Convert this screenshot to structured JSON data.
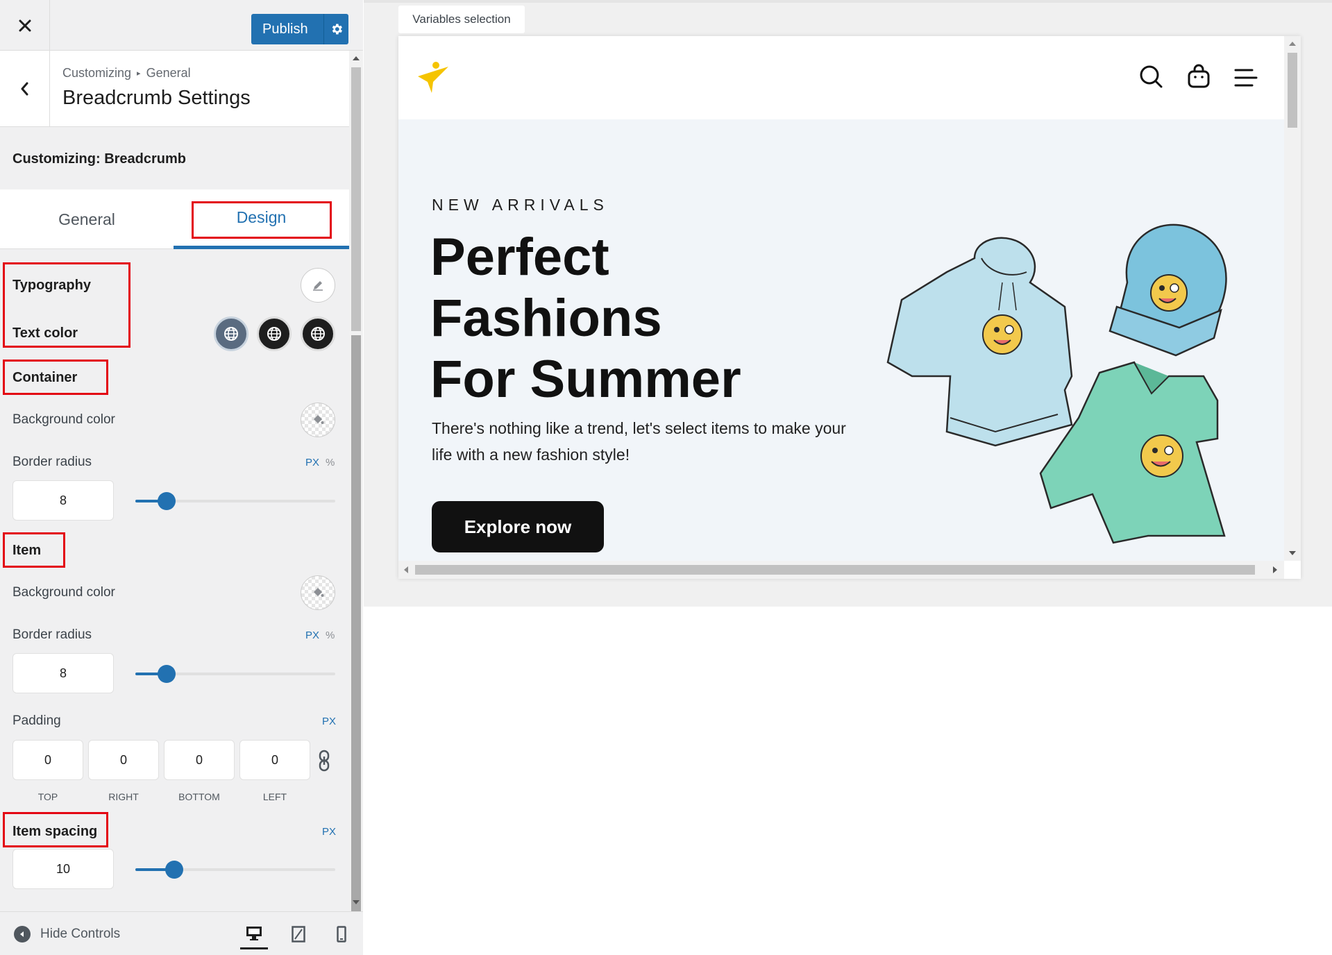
{
  "topbar": {
    "publish_label": "Publish"
  },
  "section": {
    "breadcrumb_root": "Customizing",
    "breadcrumb_parent": "General",
    "title": "Breadcrumb Settings",
    "customizing_label": "Customizing: Breadcrumb"
  },
  "tabs": {
    "general": "General",
    "design": "Design",
    "active": "Design"
  },
  "typography": {
    "heading": "Typography",
    "text_color_label": "Text color"
  },
  "container": {
    "heading": "Container",
    "bg_color_label": "Background color",
    "border_radius_label": "Border radius",
    "unit_px": "PX",
    "unit_pct": "%",
    "border_radius_value": "8"
  },
  "item": {
    "heading": "Item",
    "bg_color_label": "Background color",
    "border_radius_label": "Border radius",
    "unit_px": "PX",
    "unit_pct": "%",
    "border_radius_value": "8",
    "padding_label": "Padding",
    "padding_unit": "PX",
    "padding": {
      "top": "0",
      "right": "0",
      "bottom": "0",
      "left": "0",
      "top_label": "TOP",
      "right_label": "RIGHT",
      "bottom_label": "BOTTOM",
      "left_label": "LEFT"
    }
  },
  "item_spacing": {
    "heading": "Item spacing",
    "unit": "PX",
    "value": "10"
  },
  "bottom": {
    "hide_controls": "Hide Controls"
  },
  "preview": {
    "variables_tab": "Variables selection",
    "hero_eyebrow": "NEW ARRIVALS",
    "hero_line1": "Perfect",
    "hero_line2": "Fashions",
    "hero_line3": "For Summer",
    "hero_desc": "There's nothing like a trend, let's select items to make your life with a new fashion style!",
    "hero_button": "Explore now"
  },
  "colors": {
    "accent": "#2271b1",
    "highlight": "#e30613",
    "logo": "#f5c400"
  }
}
